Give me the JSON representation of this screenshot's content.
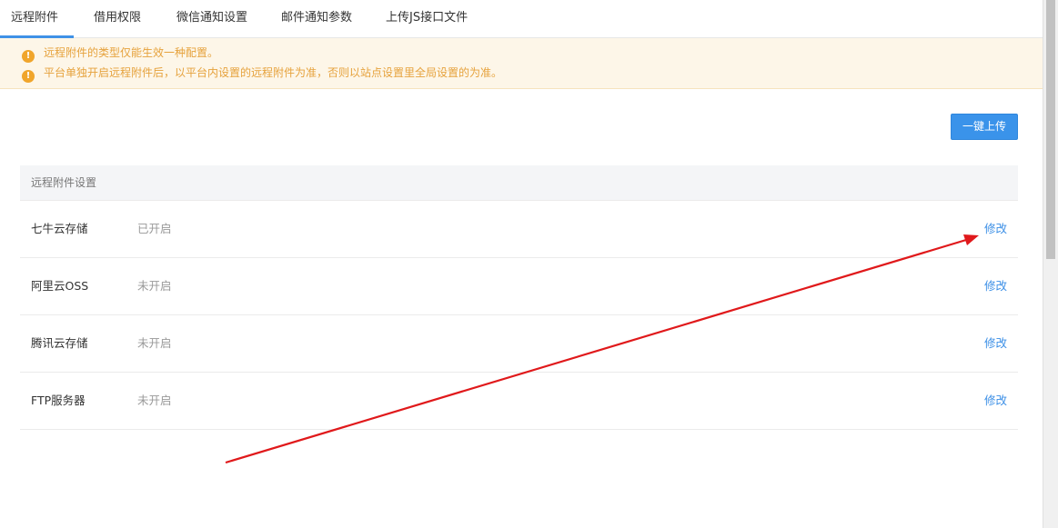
{
  "tabs": [
    {
      "label": "远程附件",
      "active": true
    },
    {
      "label": "借用权限",
      "active": false
    },
    {
      "label": "微信通知设置",
      "active": false
    },
    {
      "label": "邮件通知参数",
      "active": false
    },
    {
      "label": "上传JS接口文件",
      "active": false
    }
  ],
  "notices": [
    "远程附件的类型仅能生效一种配置。",
    "平台单独开启远程附件后，以平台内设置的远程附件为准，否则以站点设置里全局设置的为准。"
  ],
  "toolbar": {
    "upload_label": "一键上传"
  },
  "table": {
    "header": "远程附件设置",
    "rows": [
      {
        "name": "七牛云存储",
        "status": "已开启",
        "action": "修改"
      },
      {
        "name": "阿里云OSS",
        "status": "未开启",
        "action": "修改"
      },
      {
        "name": "腾讯云存储",
        "status": "未开启",
        "action": "修改"
      },
      {
        "name": "FTP服务器",
        "status": "未开启",
        "action": "修改"
      }
    ]
  },
  "colors": {
    "accent": "#3a93ea",
    "notice_text": "#e6a23c",
    "notice_bg": "#fdf6e8",
    "annotation_arrow": "#e0191b"
  }
}
